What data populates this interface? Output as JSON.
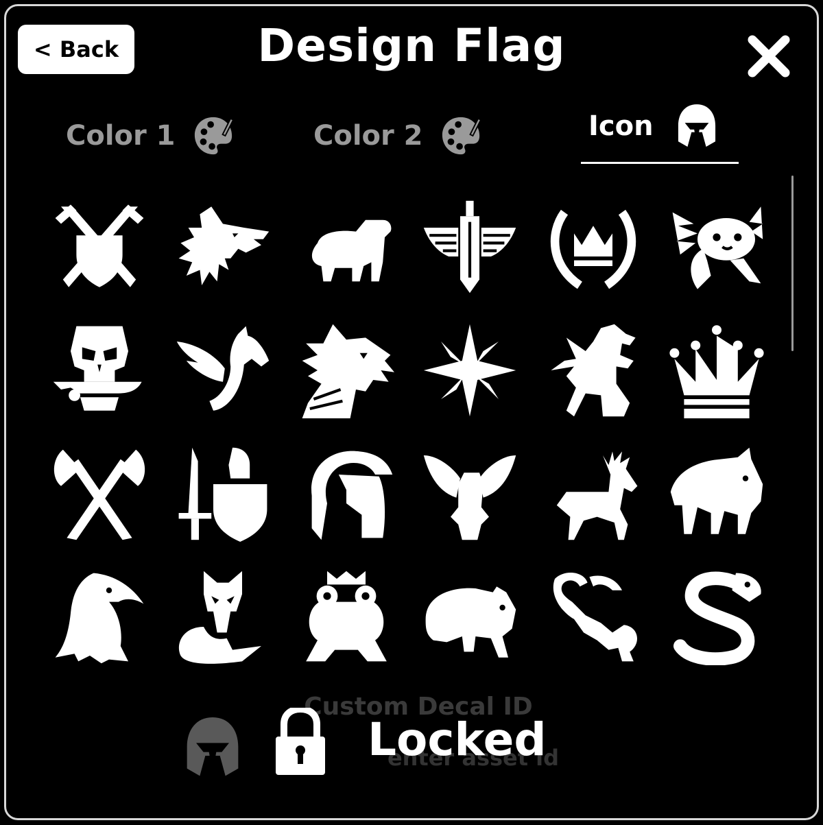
{
  "header": {
    "back_label": "< Back",
    "title": "Design Flag",
    "close_icon": "close-icon"
  },
  "tabs": [
    {
      "label": "Color 1",
      "icon": "palette-icon",
      "selected": false
    },
    {
      "label": "Color 2",
      "icon": "palette-icon",
      "selected": false
    },
    {
      "label": "Icon",
      "icon": "helmet-icon",
      "selected": true
    }
  ],
  "icons": [
    "crossed-swords-shield-icon",
    "wolf-icon",
    "capybara-icon",
    "winged-sword-icon",
    "laurel-crown-icon",
    "axolotl-icon",
    "skull-dagger-icon",
    "pegasus-icon",
    "dragon-icon",
    "star-icon",
    "griffin-icon",
    "crown-icon",
    "crossed-axes-icon",
    "knight-sword-shield-icon",
    "spartan-helmet-icon",
    "eagle-spread-icon",
    "deer-icon",
    "boar-icon",
    "eagle-head-icon",
    "fox-icon",
    "frog-king-icon",
    "bear-icon",
    "scorpion-icon",
    "snake-icon"
  ],
  "decal": {
    "label": "Custom Decal ID",
    "placeholder": "enter asset id",
    "preview_icon": "helmet-icon",
    "lock_icon": "lock-icon",
    "locked_text": "Locked"
  },
  "colors": {
    "background": "#000000",
    "accent": "#ffffff",
    "muted": "#9a9a9a"
  }
}
